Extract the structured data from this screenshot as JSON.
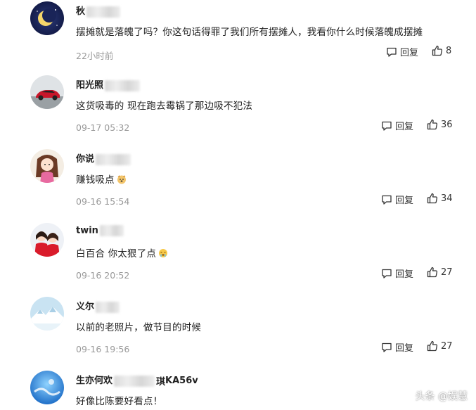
{
  "comments": [
    {
      "name_prefix": "秋",
      "name_suffix": "",
      "text": "摆摊就是落魄了吗？你这句话得罪了我们所有摆摊人，我看你什么时候落魄成摆摊",
      "time": "22小时前",
      "reply_label": "回复",
      "likes": "8",
      "emoji": ""
    },
    {
      "name_prefix": "阳光照",
      "name_suffix": "",
      "text": "这货吸毒的 现在跑去霉锅了那边吸不犯法",
      "time": "09-17 05:32",
      "reply_label": "回复",
      "likes": "36",
      "emoji": ""
    },
    {
      "name_prefix": "你说",
      "name_suffix": "",
      "text": "赚钱吸点",
      "time": "09-16 15:54",
      "reply_label": "回复",
      "likes": "34",
      "emoji": "dog-face-emoji"
    },
    {
      "name_prefix": "twin",
      "name_suffix": "",
      "text": "白百合 你太狠了点",
      "time": "09-16 20:52",
      "reply_label": "回复",
      "likes": "27",
      "emoji": "crying-emoji"
    },
    {
      "name_prefix": "义尔",
      "name_suffix": "",
      "text": "以前的老照片，做节目的时候",
      "time": "09-16 19:56",
      "reply_label": "回复",
      "likes": "27",
      "emoji": ""
    },
    {
      "name_prefix": "生亦何欢",
      "name_suffix": "KA56v",
      "text": "好像比陈要好看点！",
      "time": "",
      "reply_label": "",
      "likes": "",
      "emoji": ""
    }
  ],
  "watermark": {
    "text": "头条 @娱慧"
  },
  "colors": {
    "name": "#222222",
    "text": "#222222",
    "time": "#999999",
    "action": "#333333"
  }
}
